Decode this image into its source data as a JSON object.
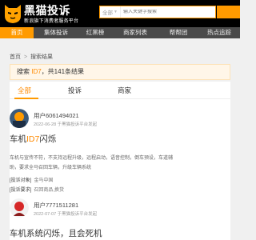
{
  "header": {
    "logo_title": "黑猫投诉",
    "logo_subtitle": "新浪旗下消费者服务平台",
    "search_scope": "全部",
    "search_placeholder": "输入关键字搜索"
  },
  "nav": {
    "items": [
      {
        "label": "首页",
        "active": true
      },
      {
        "label": "集体投诉",
        "active": false
      },
      {
        "label": "红黑榜",
        "active": false
      },
      {
        "label": "商家列表",
        "active": false
      },
      {
        "label": "帮帮团",
        "active": false
      },
      {
        "label": "热点追踪",
        "active": false
      }
    ]
  },
  "breadcrumb": {
    "home": "首页",
    "separator": ">",
    "current": "搜索结果"
  },
  "result": {
    "prefix": "搜索 ",
    "keyword": "ID7",
    "suffix": "，共141条结果"
  },
  "tabs": [
    {
      "label": "全部",
      "active": true
    },
    {
      "label": "投诉",
      "active": false
    },
    {
      "label": "商家",
      "active": false
    }
  ],
  "posts": [
    {
      "user": "用户6061494021",
      "meta": "2022-06-28 于黑猫投诉平台发起",
      "title_prefix": "车机",
      "title_highlight": "ID7",
      "title_suffix": "闪烁",
      "desc": "车机与宣传不符，不支持远程升级，远程启动，语音控制，倒车预设，车道辅助，要求全马召回车辆，升级车辆系统",
      "tags": [
        {
          "label": "[投诉对象]",
          "value": "金马中国"
        },
        {
          "label": "[投诉要求]",
          "value": "召回商品,换货"
        }
      ]
    },
    {
      "user": "用户7771511281",
      "meta": "2022-07-07 于黑猫投诉平台发起",
      "title_prefix": "车机系统闪烁，且会死机",
      "title_highlight": "",
      "title_suffix": ""
    }
  ],
  "colors": {
    "accent": "#ff9a00",
    "header_bg": "#000000",
    "nav_bg": "#4a4a4a"
  }
}
